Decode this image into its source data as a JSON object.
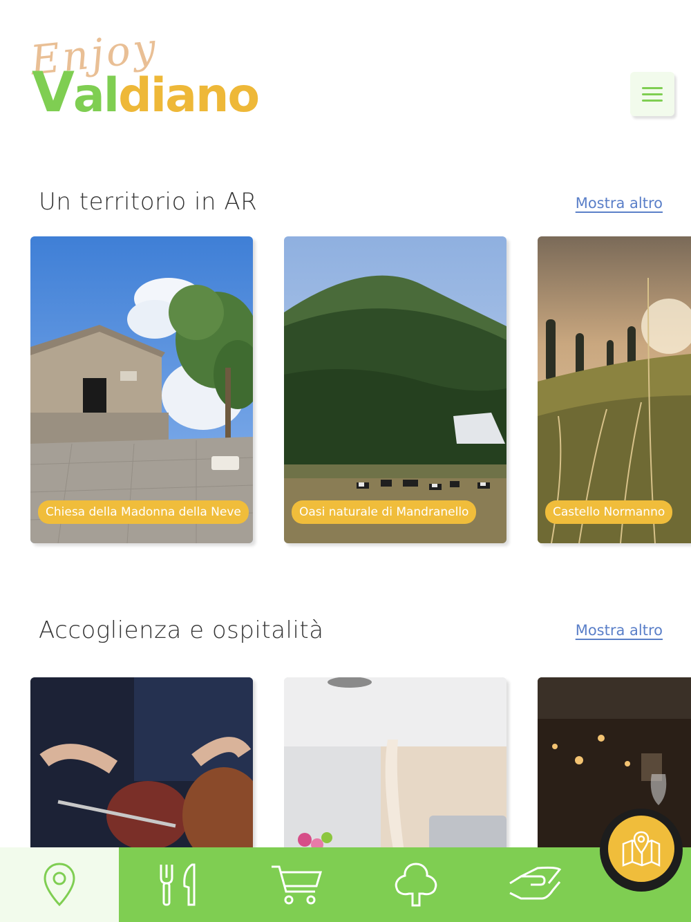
{
  "header": {
    "logo_script": "Enjoy",
    "logo_v": "V",
    "logo_al": "al",
    "logo_diano": "diano",
    "menu_icon": "hamburger-menu-icon"
  },
  "sections": [
    {
      "title": "Un territorio in AR",
      "more": "Mostra altro",
      "cards": [
        {
          "label": "Chiesa della Madonna della Neve"
        },
        {
          "label": "Oasi naturale di Mandranello"
        },
        {
          "label": "Castello Normanno"
        }
      ]
    },
    {
      "title": "Accoglienza e ospitalità",
      "more": "Mostra altro",
      "cards": [
        {
          "label": ""
        },
        {
          "label": ""
        },
        {
          "label": ""
        }
      ]
    }
  ],
  "nav": {
    "items": [
      "map-pin-icon",
      "restaurant-icon",
      "shopping-cart-icon",
      "tree-icon",
      "handshake-icon"
    ],
    "fab_icon": "map-location-icon"
  },
  "colors": {
    "green": "#7fce52",
    "yellow": "#f0bd3b",
    "light_green": "#f2fbec",
    "link_blue": "#5a7fc8"
  }
}
